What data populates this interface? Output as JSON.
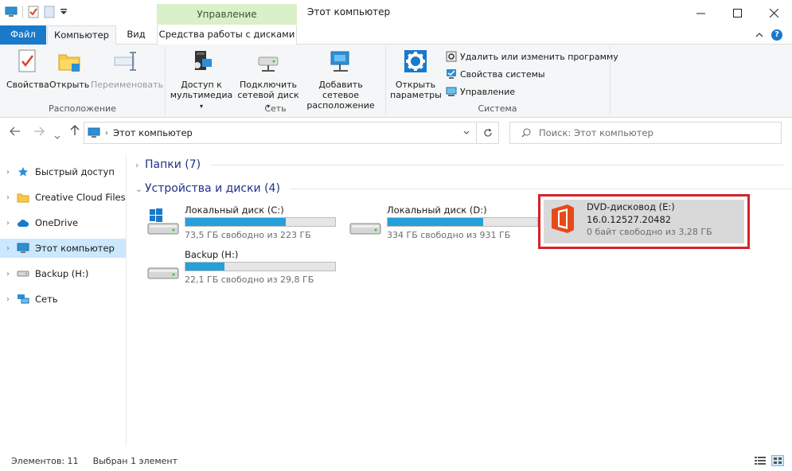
{
  "window": {
    "title": "Этот компьютер",
    "contextual_tab_group": "Управление",
    "min_icon": "minimize-icon",
    "max_icon": "maximize-icon",
    "close_icon": "close-icon"
  },
  "tabs": {
    "file": "Файл",
    "computer": "Компьютер",
    "view": "Вид",
    "drive_tools": "Средства работы с дисками"
  },
  "ribbon": {
    "groups": {
      "location": "Расположение",
      "network": "Сеть",
      "system": "Система"
    },
    "buttons": {
      "properties": "Свойства",
      "open": "Открыть",
      "rename": "Переименовать",
      "media_access_1": "Доступ к",
      "media_access_2": "мультимедиа",
      "map_drive_1": "Подключить",
      "map_drive_2": "сетевой диск",
      "add_location_1": "Добавить сетевое",
      "add_location_2": "расположение",
      "open_settings_1": "Открыть",
      "open_settings_2": "параметры"
    },
    "system_items": {
      "uninstall": "Удалить или изменить программу",
      "system_props": "Свойства системы",
      "manage": "Управление"
    }
  },
  "address": {
    "path": "Этот компьютер",
    "search_placeholder": "Поиск: Этот компьютер"
  },
  "nav": {
    "items": [
      {
        "label": "Быстрый доступ",
        "icon": "star-icon"
      },
      {
        "label": "Creative Cloud Files",
        "icon": "folder-icon"
      },
      {
        "label": "OneDrive",
        "icon": "cloud-icon"
      },
      {
        "label": "Этот компьютер",
        "icon": "computer-icon"
      },
      {
        "label": "Backup (H:)",
        "icon": "drive-icon"
      },
      {
        "label": "Сеть",
        "icon": "network-icon"
      }
    ]
  },
  "content": {
    "folders_header": "Папки (7)",
    "devices_header": "Устройства и диски (4)",
    "drives": [
      {
        "name": "Локальный диск (C:)",
        "free": "73,5 ГБ свободно из 223 ГБ",
        "used_fraction": 0.67
      },
      {
        "name": "Локальный диск (D:)",
        "free": "334 ГБ свободно из 931 ГБ",
        "used_fraction": 0.64
      },
      {
        "name": "Backup (H:)",
        "free": "22,1 ГБ свободно из 29,8 ГБ",
        "used_fraction": 0.26
      }
    ],
    "dvd": {
      "name": "DVD-дисковод (E:)",
      "version": "16.0.12527.20482",
      "free": "0 байт свободно из 3,28 ГБ"
    }
  },
  "status": {
    "count": "Элементов: 11",
    "selected": "Выбран 1 элемент"
  },
  "colors": {
    "accent": "#1979ca",
    "bar_fill": "#26a0da",
    "selection": "#cce8ff",
    "highlight_border": "#d5232b",
    "office_orange": "#e64a19"
  }
}
